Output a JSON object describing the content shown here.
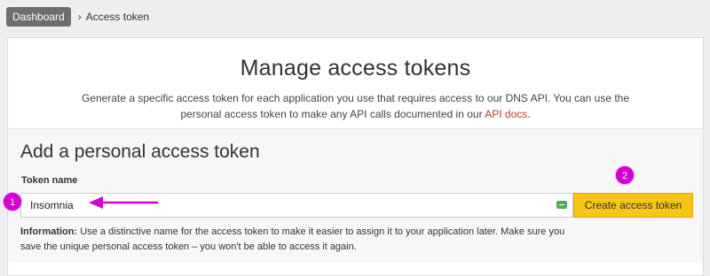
{
  "breadcrumb": {
    "home": "Dashboard",
    "separator": "›",
    "current": "Access token"
  },
  "intro": {
    "title": "Manage access tokens",
    "desc_before": "Generate a specific access token for each application you use that requires access to our DNS API. You can use the personal access token to make any API calls documented in our ",
    "desc_link": "API docs",
    "desc_after": "."
  },
  "add_token": {
    "title": "Add a personal access token",
    "field_label": "Token name",
    "input_value": "Insomnia",
    "button_label": "Create access token",
    "info_label": "Information:",
    "info_text": " Use a distinctive name for the access token to make it easier to assign it to your application later. Make sure you save the unique personal access token – you won't be able to access it again."
  },
  "annotations": {
    "step_1": "1",
    "step_2": "2",
    "marker_color": "#d400d4"
  },
  "colors": {
    "button": "#f7c515",
    "link": "#c0392b"
  }
}
